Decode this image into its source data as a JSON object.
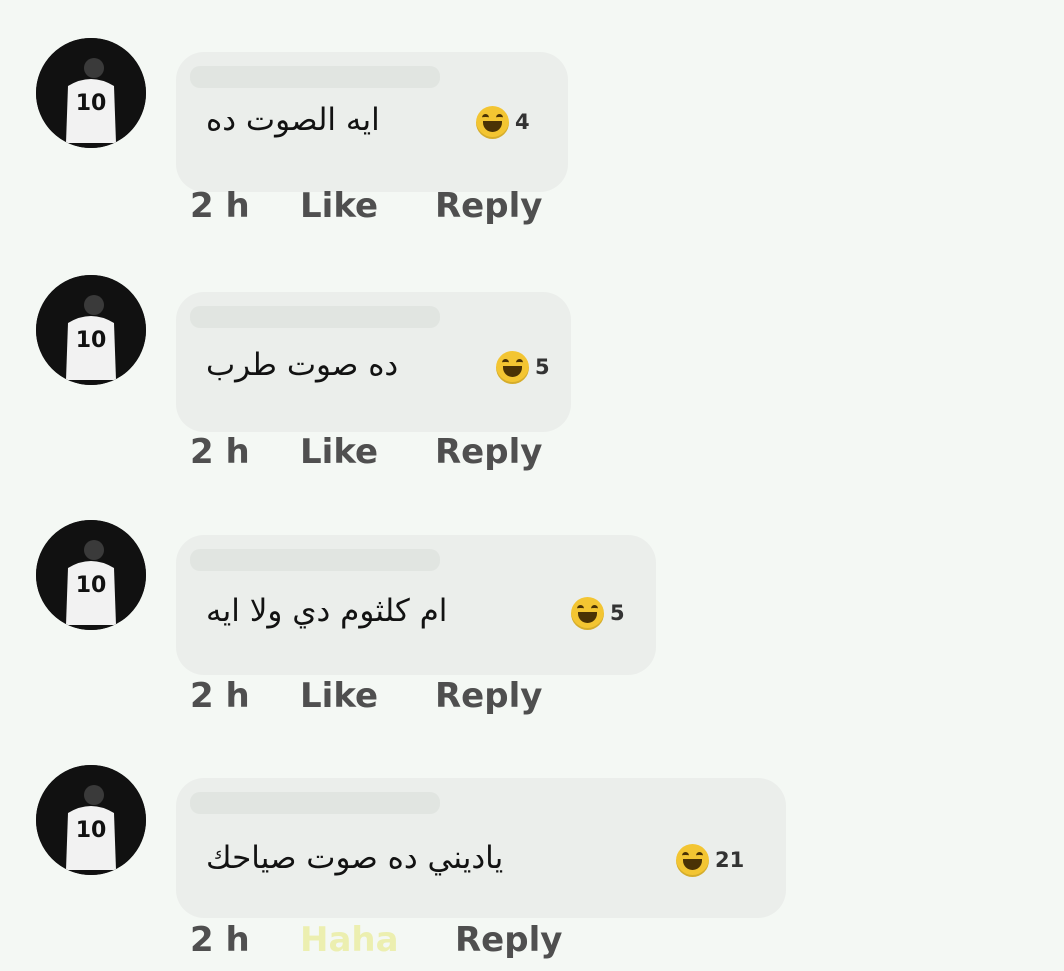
{
  "comments": [
    {
      "text": "ايه الصوت ده",
      "reaction_count": "4",
      "time": "2 h",
      "like_label": "Like",
      "reply_label": "Reply"
    },
    {
      "text": "ده صوت طرب",
      "reaction_count": "5",
      "time": "2 h",
      "like_label": "Like",
      "reply_label": "Reply"
    },
    {
      "text": "ام كلثوم دي ولا ايه",
      "reaction_count": "5",
      "time": "2 h",
      "like_label": "Like",
      "reply_label": "Reply"
    },
    {
      "text": "ياديني ده صوت صياحك",
      "reaction_count": "21",
      "time": "2 h",
      "like_label": "Haha",
      "reply_label": "Reply"
    }
  ],
  "avatar": {
    "jersey_number": "10",
    "background": "#111111",
    "jersey_color": "#f2f2f2"
  },
  "colors": {
    "page_background": "#f4f8f4",
    "bubble_background": "#ebeeeb",
    "action_text": "#4f4f4f",
    "haha_active": "#ecefb0",
    "haha_emoji": "#f3c532"
  }
}
